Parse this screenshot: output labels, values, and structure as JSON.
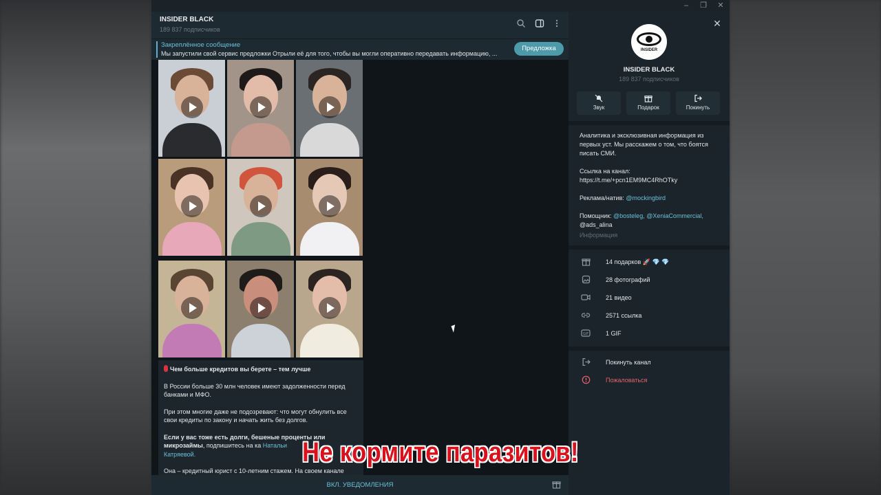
{
  "window": {
    "minimize": "‒",
    "restore": "❐",
    "close": "✕"
  },
  "chat": {
    "title": "INSIDER BLACK",
    "subscribers": "189 837 подписчиков",
    "header_icons": [
      "search-icon",
      "sidebar-toggle-icon",
      "more-vertical-icon"
    ],
    "pinned": {
      "label": "Закреплённое сообщение",
      "text": "Мы запустили свой сервис предложки  Отрыли её для того, чтобы вы могли оперативно передавать информацию, ...",
      "button": "Предложка"
    },
    "post": {
      "headline": "Чем больше кредитов вы берете – тем лучше",
      "p1": "В России больше 30 млн человек имеют задолженности перед банками и МФО.",
      "p2": "При этом многие даже не подозревают: что могут обнулить все свои кредиты  по закону и начать жить без долгов.",
      "p3_bold": "Если у вас тоже есть долги, бешеные проценты или микрозаймы",
      "p3_rest": ", подпишитесь на ка",
      "p3_link": "Натальи",
      "p3_link2": "Катряевой.",
      "p4": "Она – кредитный юрист с 10-летним стажем. На своем канале"
    },
    "notifications_button": "ВКЛ. УВЕДОМЛЕНИЯ"
  },
  "panel": {
    "logo_text": "INSIDER",
    "title": "INSIDER BLACK",
    "subscribers": "189 837 подписчиков",
    "actions": [
      {
        "label": "Звук",
        "icon": "bell-off-icon"
      },
      {
        "label": "Подарок",
        "icon": "gift-icon"
      },
      {
        "label": "Покинуть",
        "icon": "leave-icon"
      }
    ],
    "description": "Аналитика и эксклюзивная информация из первых уст. Мы расскажем о том, что боятся писать СМИ.",
    "channel_link_label": "Ссылка на канал:",
    "channel_link": "https://t.me/+pcn1EM9MC4RhOTky",
    "ads_label": "Реклама/натив:",
    "ads_handle": "@mockingbird",
    "helpers_label": "Помощник:",
    "helpers": "@bosteleg, @XeniaCommercial,",
    "helpers2": "@ads_alina",
    "info_label": "Информация",
    "media": [
      {
        "label": "14 подарков 🚀 💎 💎",
        "icon": "gift-icon"
      },
      {
        "label": "28 фотографий",
        "icon": "photo-icon"
      },
      {
        "label": "21 видео",
        "icon": "video-icon"
      },
      {
        "label": "2571 ссылка",
        "icon": "link-icon"
      },
      {
        "label": "1 GIF",
        "icon": "gif-icon"
      }
    ],
    "leave_channel": "Покинуть канал",
    "report": "Пожаловаться"
  },
  "caption": "Не кормите паразитов!"
}
